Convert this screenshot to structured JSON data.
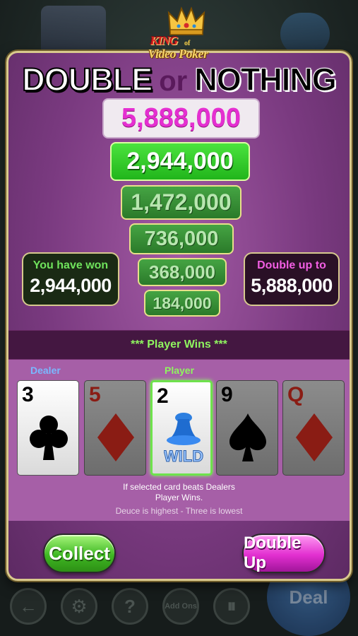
{
  "logo": {
    "king": "KING",
    "of": "of",
    "subtitle": "Video Poker"
  },
  "title": {
    "word1": "DOUBLE",
    "word2": "or",
    "word3": "NOTHING"
  },
  "ladder": {
    "top": "5,888,000",
    "current": "2,944,000",
    "lower": [
      "1,472,000",
      "736,000",
      "368,000",
      "184,000"
    ]
  },
  "won": {
    "label": "You have won",
    "value": "2,944,000"
  },
  "double_up_to": {
    "label": "Double up to",
    "value": "5,888,000"
  },
  "result": "*** Player Wins ***",
  "labels": {
    "dealer": "Dealer",
    "player": "Player"
  },
  "cards": [
    {
      "rank": "3",
      "suit": "club",
      "color": "#000000",
      "state": "dealer"
    },
    {
      "rank": "5",
      "suit": "diamond",
      "color": "#c0261e",
      "state": "dim"
    },
    {
      "rank": "2",
      "suit": "wild",
      "color": "#000000",
      "state": "selected",
      "wild_text": "WILD"
    },
    {
      "rank": "9",
      "suit": "spade",
      "color": "#000000",
      "state": "dim"
    },
    {
      "rank": "Q",
      "suit": "diamond",
      "color": "#c0261e",
      "state": "dim"
    }
  ],
  "hints": {
    "line1": "If selected card beats Dealers",
    "line2": "Player Wins.",
    "line3": "Deuce is highest - Three is lowest"
  },
  "buttons": {
    "collect": "Collect",
    "double_up": "Double Up"
  },
  "background": {
    "add_ons": "Add Ons",
    "deal": "Deal"
  },
  "colors": {
    "panel": "#7a3a80",
    "green": "#3fb823",
    "magenta": "#e22fd0"
  }
}
